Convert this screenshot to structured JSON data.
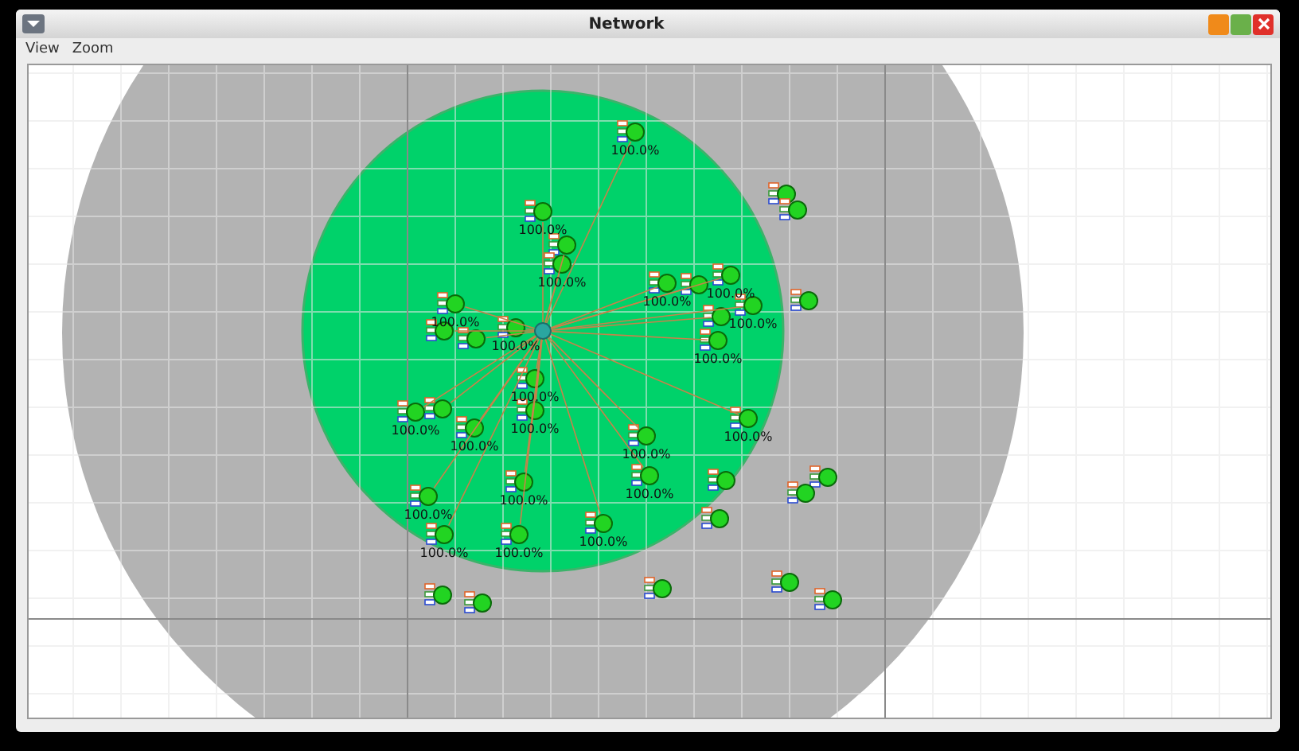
{
  "window": {
    "title": "Network"
  },
  "menu": [
    {
      "label": "View"
    },
    {
      "label": "Zoom"
    }
  ],
  "nodes": [
    {
      "kind": "linked",
      "label": "100.0%"
    },
    {
      "kind": "linked",
      "label": "100.0%"
    },
    {
      "kind": "free"
    },
    {
      "kind": "linked"
    },
    {
      "kind": "linked",
      "label": "100.0%"
    },
    {
      "kind": "free"
    },
    {
      "kind": "linked",
      "label": "100.0%"
    },
    {
      "kind": "linked",
      "label": "100.0%"
    },
    {
      "kind": "linked",
      "label": "100.0%"
    },
    {
      "kind": "linked"
    },
    {
      "kind": "free"
    },
    {
      "kind": "linked",
      "label": "100.0%"
    },
    {
      "kind": "linked"
    },
    {
      "kind": "linked"
    },
    {
      "kind": "linked",
      "label": "100.0%"
    },
    {
      "kind": "linked"
    },
    {
      "kind": "linked",
      "label": "100.0%"
    },
    {
      "kind": "linked",
      "label": "100.0%"
    },
    {
      "kind": "linked",
      "label": "100.0%"
    },
    {
      "kind": "linked"
    },
    {
      "kind": "linked",
      "label": "100.0%"
    },
    {
      "kind": "linked",
      "label": "100.0%"
    },
    {
      "kind": "linked",
      "label": "100.0%"
    },
    {
      "kind": "linked",
      "label": "100.0%"
    },
    {
      "kind": "free"
    },
    {
      "kind": "free"
    },
    {
      "kind": "linked",
      "label": "100.0%"
    },
    {
      "kind": "linked",
      "label": "100.0%"
    },
    {
      "kind": "linked",
      "label": "100.0%"
    },
    {
      "kind": "free"
    },
    {
      "kind": "linked",
      "label": "100.0%"
    },
    {
      "kind": "linked",
      "label": "100.0%"
    },
    {
      "kind": "linked",
      "label": "100.0%"
    },
    {
      "kind": "free"
    },
    {
      "kind": "free"
    },
    {
      "kind": "free"
    },
    {
      "kind": "free"
    },
    {
      "kind": "free"
    },
    {
      "kind": "free"
    }
  ]
}
